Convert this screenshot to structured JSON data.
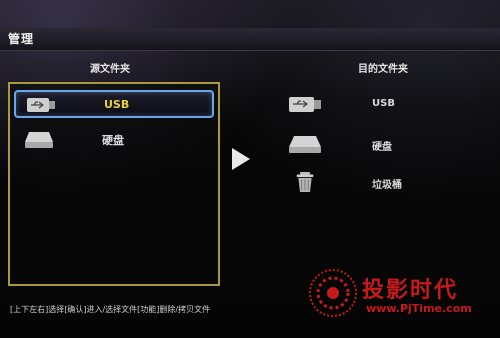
{
  "title": "管理",
  "source": {
    "header": "源文件夹",
    "items": [
      {
        "label": "USB",
        "icon": "usb-drive-icon",
        "selected": true
      },
      {
        "label": "硬盘",
        "icon": "hard-disk-icon",
        "selected": false
      }
    ]
  },
  "destination": {
    "header": "目的文件夹",
    "items": [
      {
        "label": "USB",
        "icon": "usb-drive-icon"
      },
      {
        "label": "硬盘",
        "icon": "hard-disk-icon"
      },
      {
        "label": "垃圾桶",
        "icon": "trash-icon"
      }
    ]
  },
  "hint": "[上下左右]选择[确认]进入/选择文件[功能]删除/拷贝文件",
  "watermark": {
    "text": "投影时代",
    "url": "www.PjTime.com"
  },
  "colors": {
    "selection_border": "#6aa6e8",
    "selected_text": "#e8d23a",
    "panel_border": "#a89a3c",
    "watermark": "#c41a1a"
  }
}
